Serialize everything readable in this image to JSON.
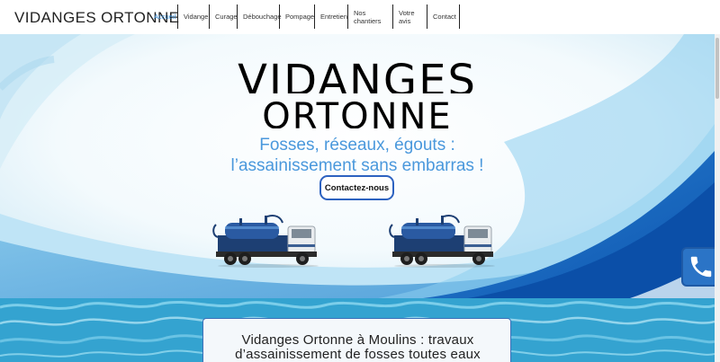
{
  "header": {
    "brand": "VIDANGES ORTONNE",
    "nav": [
      {
        "label": "Accueil",
        "active": true
      },
      {
        "label": "Vidange"
      },
      {
        "label": "Curage"
      },
      {
        "label": "Débouchage"
      },
      {
        "label": "Pompage"
      },
      {
        "label": "Entretien"
      },
      {
        "label": "Nos chantiers"
      },
      {
        "label": "Votre avis"
      },
      {
        "label": "Contact"
      }
    ]
  },
  "hero": {
    "title_line1": "VIDANGES",
    "title_line2": "ORTONNE",
    "tagline_line1": "Fosses, réseaux, égouts :",
    "tagline_line2": "l’assainissement sans embarras !",
    "cta_label": "Contactez-nous"
  },
  "intro": {
    "title_line1": "Vidanges Ortonne à Moulins : travaux",
    "title_line2": "d’assainissement de fosses toutes eaux"
  },
  "floating": {
    "icon": "phone-icon"
  },
  "colors": {
    "accent": "#3a8fd9",
    "tagline": "#4a98dc",
    "button_border": "#2d62c0",
    "phone_bg": "#2b74c6",
    "wave_dark": "#1a6fc6",
    "pool": "#3aa9d4"
  }
}
